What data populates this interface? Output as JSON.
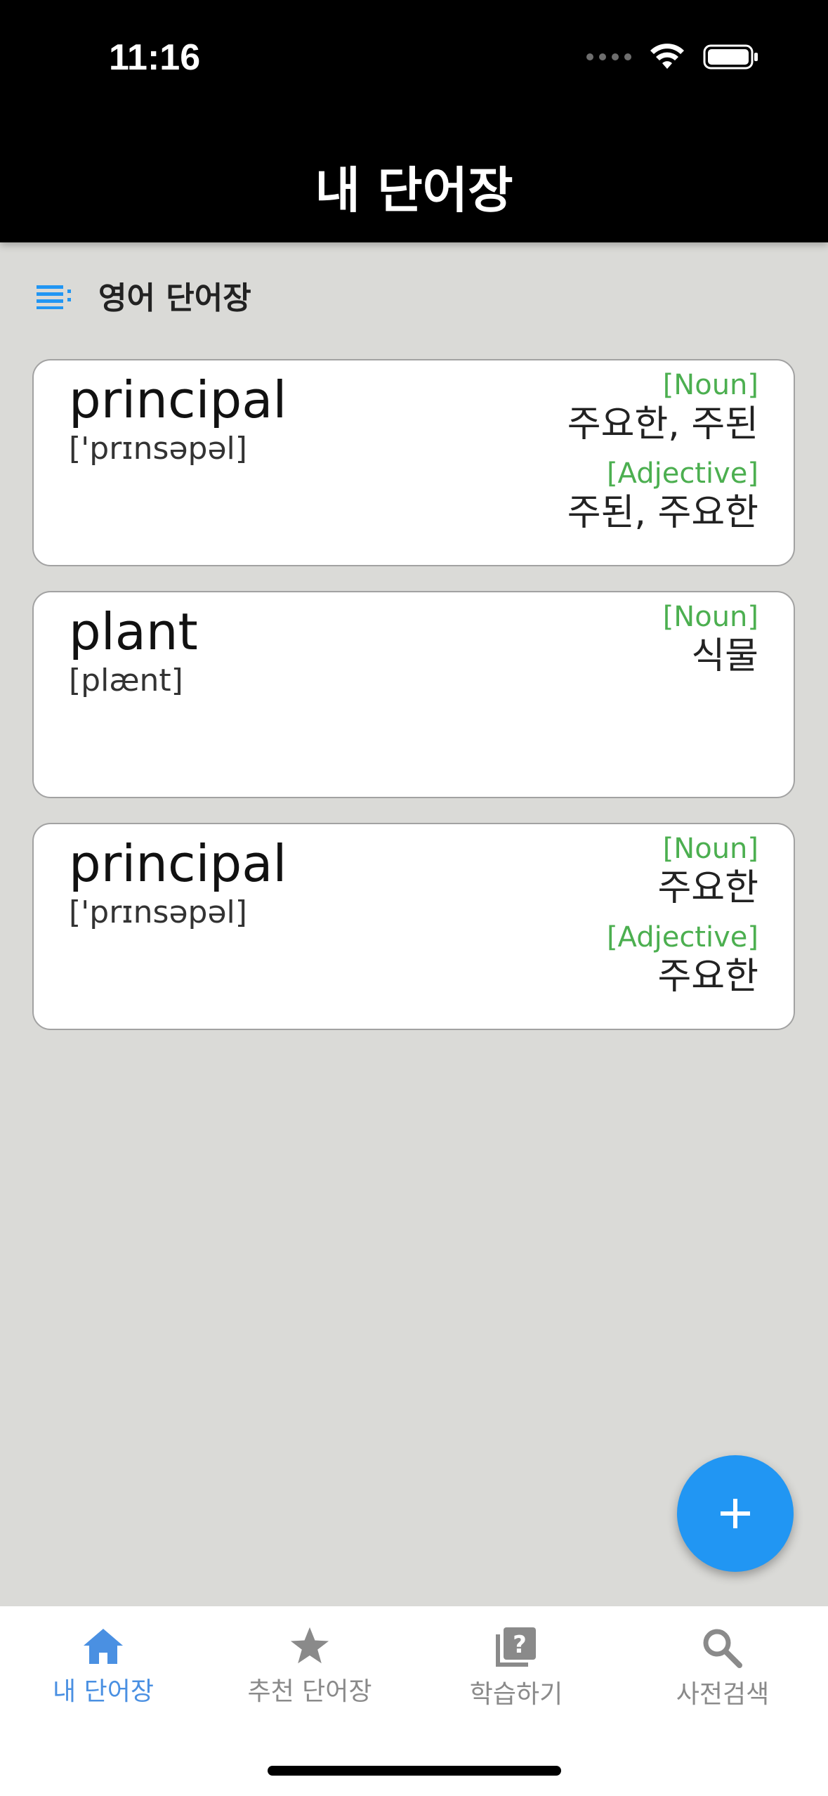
{
  "status": {
    "time": "11:16"
  },
  "header": {
    "title": "내 단어장"
  },
  "book": {
    "name": "영어 단어장",
    "icon": "list-icon"
  },
  "cards": [
    {
      "word": "principal",
      "phonetic": "['prɪnsəpəl]",
      "defs": [
        {
          "pos": "[Noun]",
          "meaning": "주요한, 주된"
        },
        {
          "pos": "[Adjective]",
          "meaning": "주된, 주요한"
        }
      ]
    },
    {
      "word": "plant",
      "phonetic": "[plænt]",
      "defs": [
        {
          "pos": "[Noun]",
          "meaning": "식물"
        }
      ]
    },
    {
      "word": "principal",
      "phonetic": "['prɪnsəpəl]",
      "defs": [
        {
          "pos": "[Noun]",
          "meaning": "주요한"
        },
        {
          "pos": "[Adjective]",
          "meaning": "주요한"
        }
      ]
    }
  ],
  "fab": {
    "icon": "plus-icon"
  },
  "nav": [
    {
      "label": "내 단어장",
      "icon": "home-icon",
      "active": true
    },
    {
      "label": "추천 단어장",
      "icon": "star-icon",
      "active": false
    },
    {
      "label": "학습하기",
      "icon": "quiz-icon",
      "active": false
    },
    {
      "label": "사전검색",
      "icon": "search-icon",
      "active": false
    }
  ],
  "colors": {
    "accent": "#2196f3",
    "pos": "#4caf50",
    "nav_active": "#4a90e2",
    "nav_inactive": "#8a8a8a"
  }
}
